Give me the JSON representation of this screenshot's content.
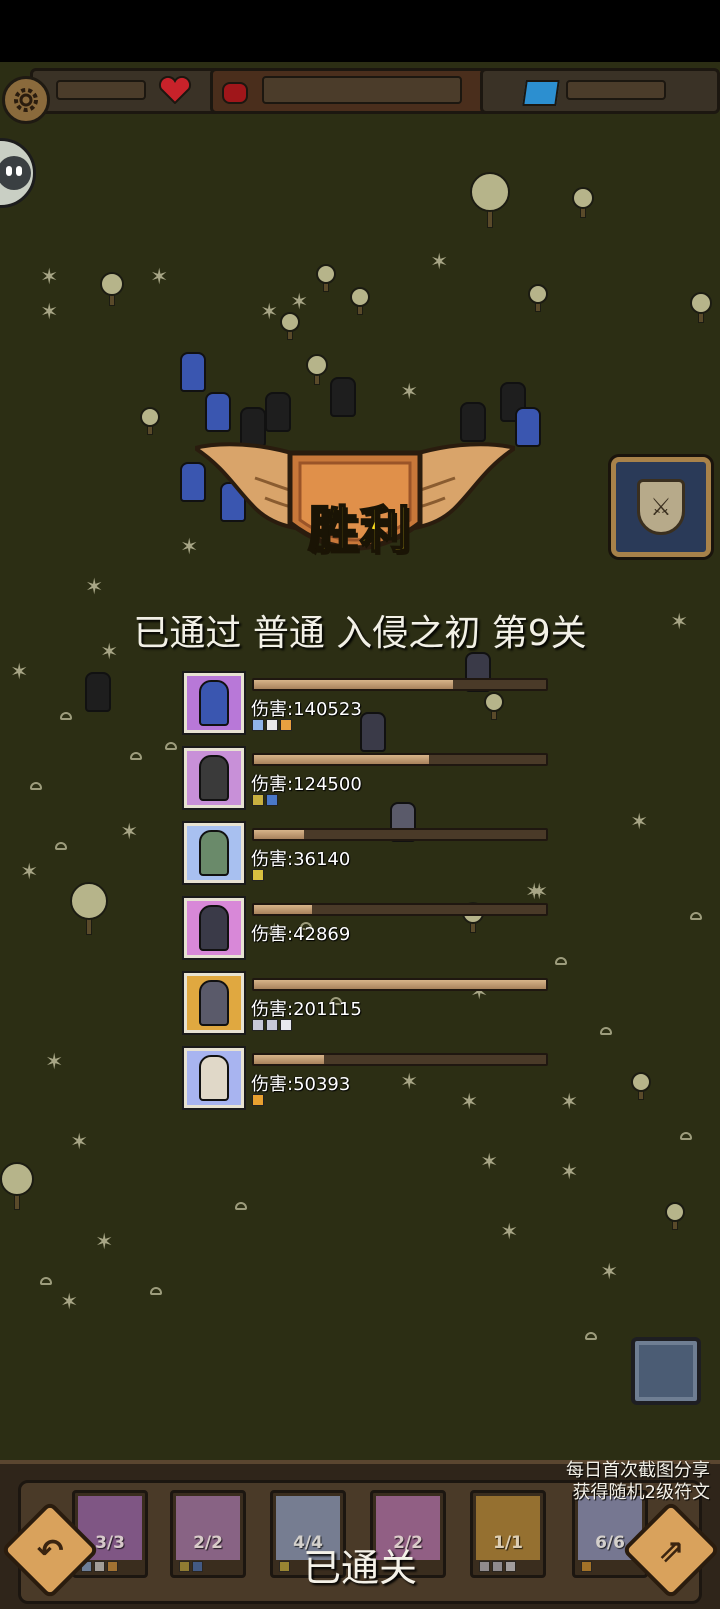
{
  "victory": {
    "title": "胜利",
    "stage_text": "已通过 普通 入侵之初 第9关"
  },
  "results": [
    {
      "damage_label": "伤害:140523",
      "damage_value": 140523,
      "fill": 0.68,
      "portrait_bg": "#b878d8",
      "figure_color": "#3a56b0",
      "runes": [
        "#8fb4e8",
        "#e8e8e8",
        "#e8a040"
      ]
    },
    {
      "damage_label": "伤害:124500",
      "damage_value": 124500,
      "fill": 0.6,
      "portrait_bg": "#c890d8",
      "figure_color": "#3a3a3a",
      "runes": [
        "#c8b040",
        "#4a78c8"
      ]
    },
    {
      "damage_label": "伤害:36140",
      "damage_value": 36140,
      "fill": 0.17,
      "portrait_bg": "#a8c0f0",
      "figure_color": "#6a8a6a",
      "runes": [
        "#d8c040"
      ]
    },
    {
      "damage_label": "伤害:42869",
      "damage_value": 42869,
      "fill": 0.2,
      "portrait_bg": "#d888d8",
      "figure_color": "#3a3a48",
      "runes": []
    },
    {
      "damage_label": "伤害:201115",
      "damage_value": 201115,
      "fill": 1.0,
      "portrait_bg": "#e0a840",
      "figure_color": "#5a5a6a",
      "runes": [
        "#c8c8d8",
        "#c8c8d8",
        "#e8e8f0"
      ]
    },
    {
      "damage_label": "伤害:50393",
      "damage_value": 50393,
      "fill": 0.24,
      "portrait_bg": "#a8b4f0",
      "figure_color": "#e0d8c8",
      "runes": [
        "#e8a030"
      ]
    }
  ],
  "bottom_bar": {
    "cleared_text": "已通关",
    "share_line1": "每日首次截图分享",
    "share_line2": "获得随机2级符文",
    "back_icon": "undo-arrow-icon",
    "share_icon": "share-arrow-icon",
    "slots": [
      {
        "count": "3/3",
        "bg": "#b878d8",
        "fig": "#3a56b0"
      },
      {
        "count": "2/2",
        "bg": "#c890d8",
        "fig": "#3a3a3a"
      },
      {
        "count": "4/4",
        "bg": "#a8c0f0",
        "fig": "#6a8a6a"
      },
      {
        "count": "2/2",
        "bg": "#d888d8",
        "fig": "#3a3a48"
      },
      {
        "count": "1/1",
        "bg": "#e0a840",
        "fig": "#5a5a6a"
      },
      {
        "count": "6/6",
        "bg": "#a8b4f0",
        "fig": "#e0d8c8"
      }
    ]
  },
  "hud": {
    "settings_icon": "gear-icon",
    "life_icon": "heart-icon",
    "gem_icon": "blue-gem-icon",
    "attack_icon": "attack-shield-icon",
    "speed_icon": "speed-frame-icon",
    "chat_icon": "chat-face-icon"
  }
}
